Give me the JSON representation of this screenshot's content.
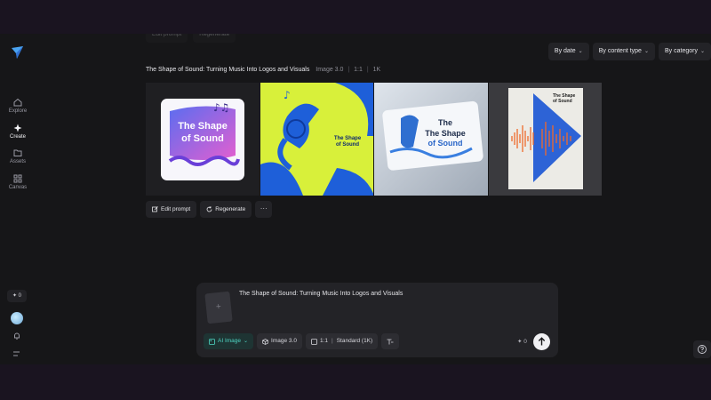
{
  "sidebar": {
    "items": [
      {
        "label": "Explore",
        "icon": "home-icon"
      },
      {
        "label": "Create",
        "icon": "sparkle-icon"
      },
      {
        "label": "Assets",
        "icon": "folder-icon"
      },
      {
        "label": "Canvas",
        "icon": "grid-icon"
      }
    ],
    "credits": "✦ 0"
  },
  "top_faded": {
    "edit_label": "Edit prompt",
    "regen_label": "Regenerate"
  },
  "filters": [
    {
      "label": "By date"
    },
    {
      "label": "By content type"
    },
    {
      "label": "By category"
    }
  ],
  "result": {
    "title": "The Shape of Sound: Turning Music Into Logos and Visuals",
    "model": "Image 3.0",
    "ratio": "1:1",
    "resolution": "1K",
    "images": [
      {
        "text_line1": "The Shape",
        "text_line2": "of Sound"
      },
      {
        "text_line1": "The Shape",
        "text_line2": "of Sound"
      },
      {
        "text_line1": "The",
        "text_line2": "The Shape",
        "text_line3": "of Sound"
      },
      {
        "text_line1": "The Shape",
        "text_line2": "of Sound"
      }
    ]
  },
  "actions": {
    "edit_label": "Edit prompt",
    "regen_label": "Regenerate",
    "more_label": "···"
  },
  "prompt": {
    "text": "The Shape of Sound: Turning Music Into Logos and Visuals",
    "thumb_plus": "+",
    "tools": {
      "ai_label": "AI Image",
      "model_label": "Image 3.0",
      "ratio_label": "1:1",
      "quality_label": "Standard (1K)"
    },
    "credits": "✦ 0"
  },
  "colors": {
    "accent_teal": "#4fd6c4",
    "bg": "#161618",
    "panel": "#232327"
  }
}
